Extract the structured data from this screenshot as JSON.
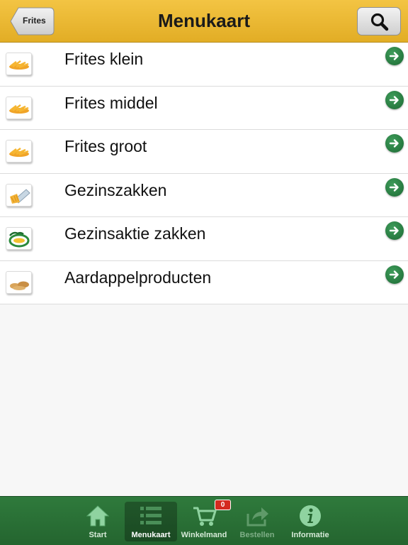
{
  "header": {
    "title": "Menukaart",
    "back_label": "Frites",
    "search_icon": "search-icon"
  },
  "menu": {
    "items": [
      {
        "label": "Frites klein",
        "icon": "fries-icon"
      },
      {
        "label": "Frites middel",
        "icon": "fries-icon"
      },
      {
        "label": "Frites groot",
        "icon": "fries-icon"
      },
      {
        "label": "Gezinszakken",
        "icon": "fries-bag-icon"
      },
      {
        "label": "Gezinsaktie zakken",
        "icon": "plaza-logo-icon"
      },
      {
        "label": "Aardappelproducten",
        "icon": "potato-products-icon"
      }
    ]
  },
  "tabbar": {
    "tabs": [
      {
        "label": "Start",
        "icon": "home-icon"
      },
      {
        "label": "Menukaart",
        "icon": "list-icon",
        "active": true
      },
      {
        "label": "Winkelmand",
        "icon": "cart-icon"
      },
      {
        "label": "Bestellen",
        "icon": "share-icon",
        "disabled": true
      },
      {
        "label": "Informatie",
        "icon": "info-icon"
      }
    ],
    "cart_count": "0"
  },
  "colors": {
    "header": "#e8b52e",
    "tabbar": "#2a7036",
    "arrow": "#2a7d41",
    "badge": "#d42a1f"
  }
}
